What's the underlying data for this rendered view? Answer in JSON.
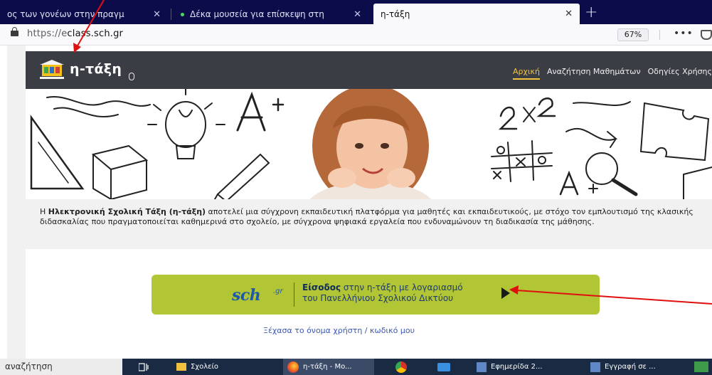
{
  "browser": {
    "tabs": [
      {
        "label": "ος των γονέων στην πραγμ"
      },
      {
        "label": "Δέκα μουσεία για επίσκεψη στη"
      },
      {
        "label": "η-τάξη"
      }
    ],
    "tab_close_glyph": "✕",
    "new_tab_glyph": "+",
    "url_prefix": "https://e",
    "url_host": "class.sch.gr",
    "zoom": "67%",
    "more_glyph": "•••"
  },
  "site": {
    "title": "η-τάξη",
    "nav": [
      {
        "label": "Αρχική",
        "active": true
      },
      {
        "label": "Αναζήτηση Μαθημάτων",
        "active": false
      },
      {
        "label": "Οδηγίες Χρήσης",
        "active": false
      }
    ],
    "intro_pre": "Η ",
    "intro_bold": "Ηλεκτρονική Σχολική Τάξη (η-τάξη)",
    "intro_rest": " αποτελεί μια σύγχρονη εκπαιδευτική πλατφόρμα για μαθητές και εκπαιδευτικούς, με στόχο τον εμπλουτισμό της κλασικής διδασκαλίας που πραγματοποιείται καθημερινά στο σχολείο, με σύγχρονα ψηφιακά εργαλεία που ενδυναμώνουν τη διαδικασία της μάθησης.",
    "login": {
      "logo_text": "sch",
      "logo_sub": ".gr",
      "bold": "Είσοδος",
      "line1_rest": " στην η-τάξη με λογαριασμό",
      "line2": "του Πανελλήνιου Σχολικού Δικτύου"
    },
    "forgot": "Ξέχασα το όνομα χρήστη / κωδικό μου"
  },
  "taskbar": {
    "search": "αναζήτηση",
    "items": [
      {
        "label": "Σχολείο"
      },
      {
        "label": "η-τάξη - Mo..."
      },
      {
        "label": "Εφημερίδα 2..."
      },
      {
        "label": "Εγγραφή σε ..."
      }
    ]
  },
  "colors": {
    "tab_strip": "#0c0c4a",
    "site_header": "#3b3d45",
    "nav_active": "#f5c33a",
    "login_box": "#b1c535",
    "annotation_arrow": "#e01010"
  }
}
